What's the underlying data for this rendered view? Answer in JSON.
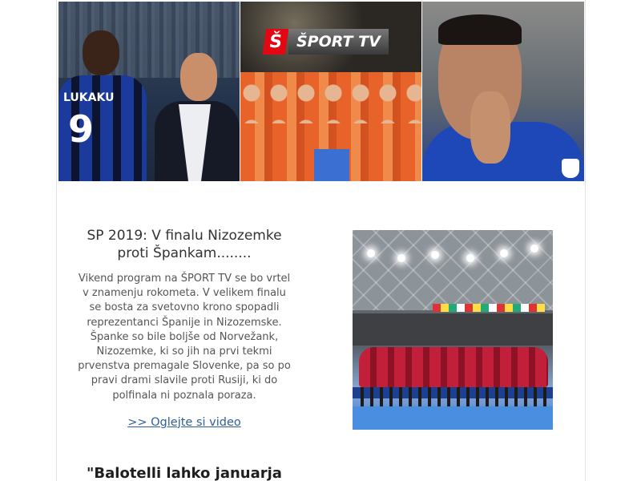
{
  "banner": {
    "panel1": {
      "jersey_name": "LUKAKU",
      "jersey_number": "9"
    },
    "panel2": {
      "logo_mark": "Š",
      "logo_text": "ŠPORT TV"
    },
    "panel3": {}
  },
  "article": {
    "title": "SP 2019: V finalu Nizozemke proti Špankam........",
    "body": "Vikend program na ŠPORT TV se bo vrtel v znamenju rokometa. V velikem finalu se bosta za svetovno krono spopadli reprezentanci Španije in Nizozemske. Španke so bile boljše od Norvežank, Nizozemke, ki so jih na prvi tekmi prvenstva premagale Slovenke, pa so po pravi drami slavile proti Rusiji, ki do polfinala ni poznala poraza.",
    "link_text": ">> Oglejte si video"
  },
  "next_article": {
    "title": "\"Balotelli lahko januarja"
  },
  "colors": {
    "link": "#2d5f9a",
    "title": "#333333",
    "body": "#555555",
    "brand_red": "#e30613"
  }
}
